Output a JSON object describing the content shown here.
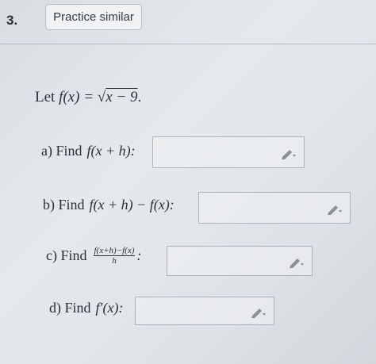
{
  "header": {
    "question_number": "3.",
    "practice_button_label": "Practice similar"
  },
  "problem": {
    "prefix": "Let",
    "function_lhs": "f(x) =",
    "radicand": "x − 9",
    "suffix": "."
  },
  "parts": [
    {
      "label": "a) Find",
      "expression": "f(x + h):"
    },
    {
      "label": "b) Find",
      "expression": "f(x + h) − f(x):"
    },
    {
      "label": "c) Find",
      "fraction_numerator": "f(x+h)−f(x)",
      "fraction_denominator": "h",
      "suffix": ":"
    },
    {
      "label": "d) Find",
      "expression": "f′(x):"
    }
  ],
  "icons": {
    "edit": "pencil-icon"
  }
}
